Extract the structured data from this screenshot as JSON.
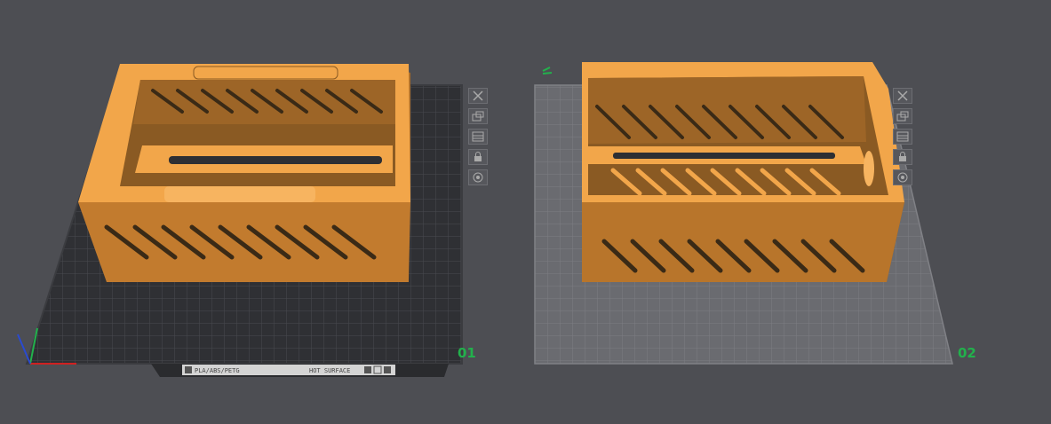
{
  "plates": [
    {
      "id": "01",
      "label": "01",
      "selected": true,
      "surface_strip": {
        "material": "PLA/ABS/PETG",
        "surface": "HOT SURFACE"
      }
    },
    {
      "id": "02",
      "label": "02",
      "selected": false
    }
  ],
  "toolbar_icons": [
    "close-icon",
    "arrange-icon",
    "layers-icon",
    "lock-icon",
    "settings-icon"
  ],
  "colors": {
    "background": "#4d4e53",
    "model": "#f2a64a",
    "model_shade": "#8a5a23",
    "plate_dark": "#2f3034",
    "plate_light": "#6a6b70",
    "plate_label": "#22b14c"
  }
}
